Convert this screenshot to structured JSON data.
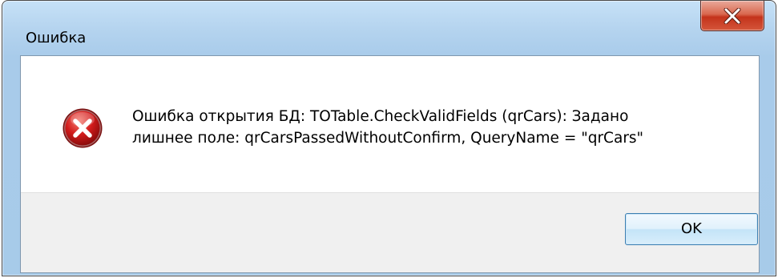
{
  "window": {
    "title": "Ошибка",
    "close_icon": "close-x-icon"
  },
  "dialog": {
    "icon": "error-icon",
    "message_line1": "Ошибка открытия БД: TOTable.CheckValidFields (qrCars): Задано",
    "message_line2": "лишнее поле: qrCarsPassedWithoutConfirm, QueryName = \"qrCars\"",
    "ok_label": "OK"
  },
  "colors": {
    "frame": "#a8cbea",
    "close_button": "#c4331b",
    "error_icon": "#d21b1b",
    "button_bar": "#f0f0f0",
    "ok_border": "#3c7fb1"
  }
}
